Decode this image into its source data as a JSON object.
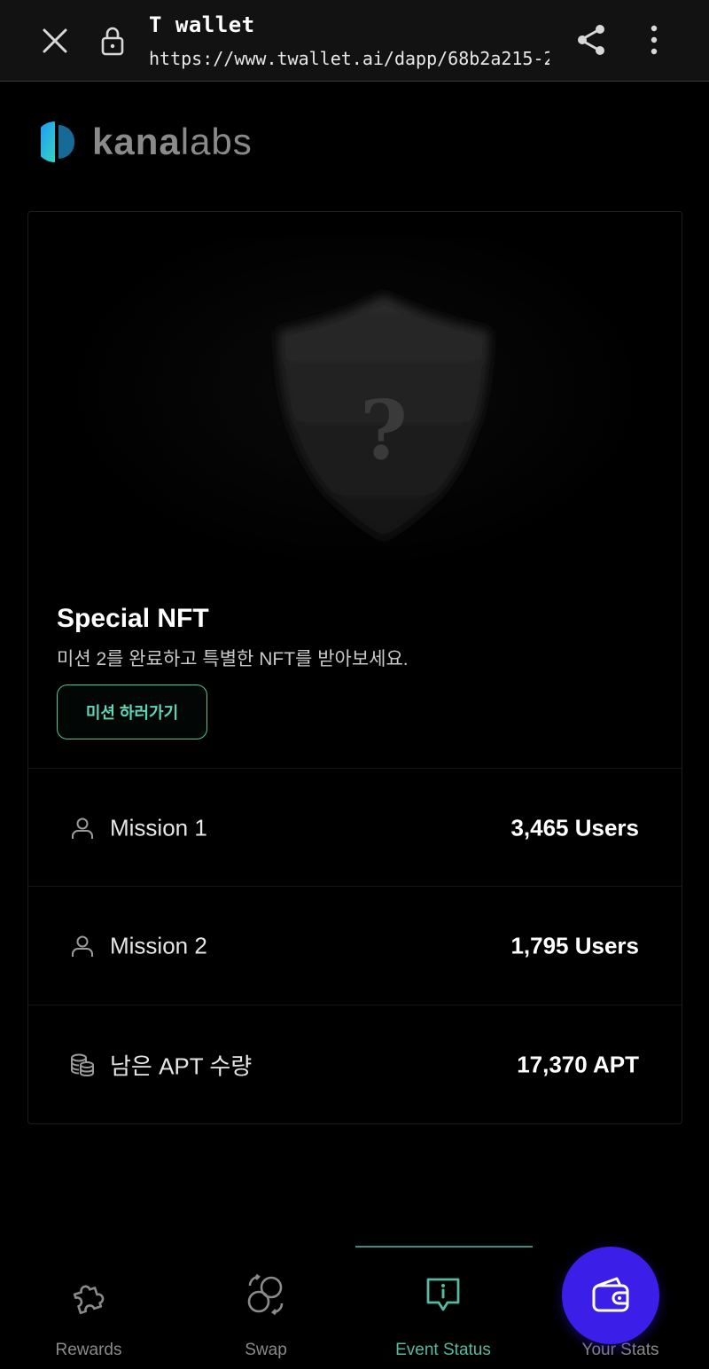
{
  "browser": {
    "title": "T wallet",
    "url": "https://www.twallet.ai/dapp/68b2a215-28e4-456"
  },
  "logo": {
    "text_bold": "kana",
    "text_light": "labs"
  },
  "nft": {
    "placeholder_glyph": "?",
    "title": "Special NFT",
    "description": "미션 2를 완료하고 특별한 NFT를 받아보세요.",
    "button_label": "미션 하러가기"
  },
  "stats": [
    {
      "icon": "user-icon",
      "label": "Mission 1",
      "value": "3,465 Users"
    },
    {
      "icon": "user-icon",
      "label": "Mission 2",
      "value": "1,795 Users"
    },
    {
      "icon": "coins-icon",
      "label": "남은 APT 수량",
      "value": "17,370 APT"
    }
  ],
  "bottom_nav": {
    "items": [
      {
        "icon": "puzzle-icon",
        "label": "Rewards",
        "active": false
      },
      {
        "icon": "swap-icon",
        "label": "Swap",
        "active": false
      },
      {
        "icon": "info-chat-icon",
        "label": "Event Status",
        "active": true
      },
      {
        "icon": "wallet-icon",
        "label": "Your Stats",
        "active": false
      }
    ]
  },
  "colors": {
    "accent": "#54b9a0",
    "fab": "#3b1ee8",
    "background": "#000000"
  }
}
